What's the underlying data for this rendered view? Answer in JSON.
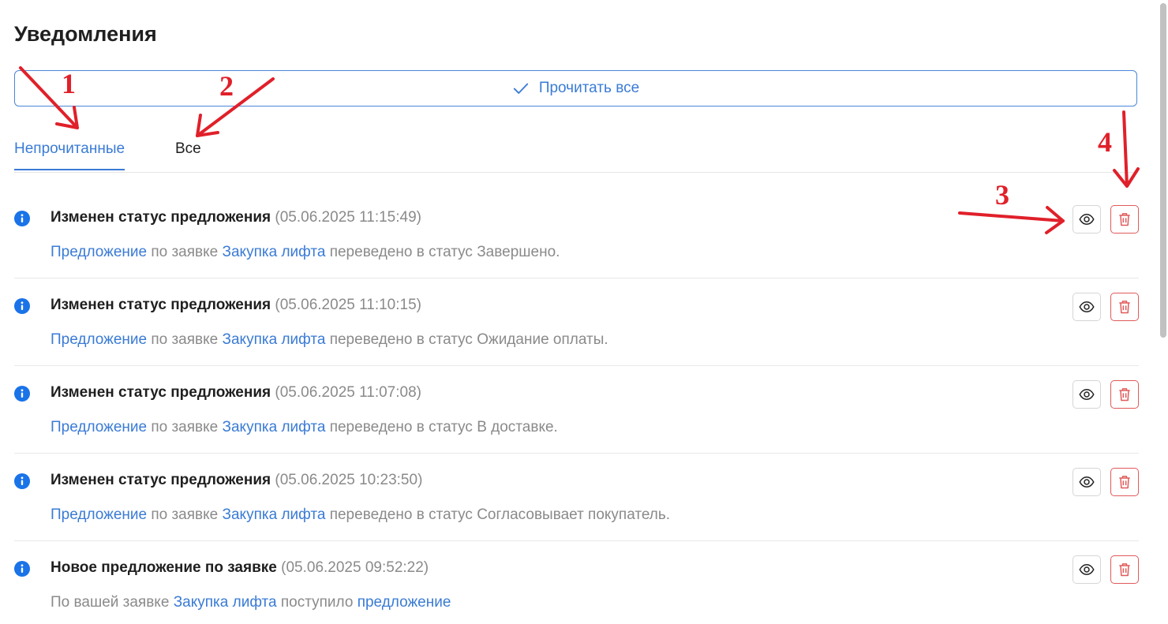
{
  "header": {
    "title": "Уведомления"
  },
  "read_all": {
    "label": "Прочитать все",
    "icon": "check-icon"
  },
  "tabs": [
    {
      "label": "Непрочитанные",
      "active": true
    },
    {
      "label": "Все",
      "active": false
    }
  ],
  "notifications": [
    {
      "title": "Изменен статус предложения",
      "time": "(05.06.2025 11:15:49)",
      "body": {
        "link1": "Предложение",
        "text1": " по заявке ",
        "link2": "Закупка лифта",
        "text2": " переведено в статус Завершено."
      }
    },
    {
      "title": "Изменен статус предложения",
      "time": "(05.06.2025 11:10:15)",
      "body": {
        "link1": "Предложение",
        "text1": " по заявке ",
        "link2": "Закупка лифта",
        "text2": " переведено в статус Ожидание оплаты."
      }
    },
    {
      "title": "Изменен статус предложения",
      "time": "(05.06.2025 11:07:08)",
      "body": {
        "link1": "Предложение",
        "text1": " по заявке ",
        "link2": "Закупка лифта",
        "text2": " переведено в статус В доставке."
      }
    },
    {
      "title": "Изменен статус предложения",
      "time": "(05.06.2025 10:23:50)",
      "body": {
        "link1": "Предложение",
        "text1": " по заявке ",
        "link2": "Закупка лифта",
        "text2": " переведено в статус Согласовывает покупатель."
      }
    },
    {
      "title": "Новое предложение по заявке",
      "time": "(05.06.2025 09:52:22)",
      "body": {
        "text0": "По вашей заявке ",
        "link2": "Закупка лифта",
        "text1": " поступило ",
        "link3": "предложение"
      }
    }
  ],
  "icons": {
    "info": "info-icon",
    "view": "eye-icon",
    "delete": "trash-icon"
  },
  "colors": {
    "accent": "#3a7bd5",
    "danger": "#e05a5a",
    "annotation": "#e0202a",
    "muted": "#8a8a8a"
  },
  "annotations": {
    "labels": [
      "1",
      "2",
      "3",
      "4"
    ]
  }
}
